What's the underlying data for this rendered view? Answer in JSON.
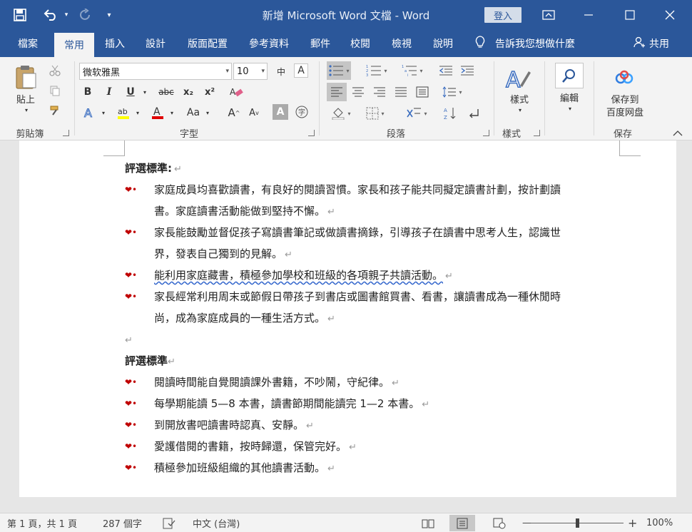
{
  "titlebar": {
    "title": "新增 Microsoft Word 文檔  -  Word",
    "login_label": "登入",
    "customize_label": "▾"
  },
  "tabs": [
    {
      "label": "檔案",
      "active": false
    },
    {
      "label": "常用",
      "active": true
    },
    {
      "label": "插入",
      "active": false
    },
    {
      "label": "設計",
      "active": false
    },
    {
      "label": "版面配置",
      "active": false
    },
    {
      "label": "參考資料",
      "active": false
    },
    {
      "label": "郵件",
      "active": false
    },
    {
      "label": "校閱",
      "active": false
    },
    {
      "label": "檢視",
      "active": false
    },
    {
      "label": "說明",
      "active": false
    }
  ],
  "tell_me": "告訴我您想做什麼",
  "share_label": "共用",
  "ribbon": {
    "clipboard": {
      "paste_label": "貼上",
      "group_label": "剪貼簿"
    },
    "font": {
      "font_name": "微软雅黑",
      "font_size": "10",
      "group_label": "字型",
      "bold": "B",
      "italic": "I",
      "underline": "U",
      "strike": "abc",
      "subscript": "x₂",
      "superscript": "x²",
      "case": "Aa",
      "grow": "A",
      "shrink": "A",
      "char_shade": "A",
      "phonetic": "中",
      "border_char": "A"
    },
    "paragraph": {
      "group_label": "段落"
    },
    "styles": {
      "label": "樣式",
      "group_label": "樣式"
    },
    "editing": {
      "label": "編輯"
    },
    "save": {
      "label_line1": "保存到",
      "label_line2": "百度网盘",
      "group_label": "保存"
    }
  },
  "document": {
    "section1": {
      "heading": "評選標準:",
      "items": [
        {
          "lines": [
            "家庭成員均喜歡讀書，有良好的閱讀習慣。家長和孩子能共同擬定讀書計劃，按計劃讀",
            "書。家庭讀書活動能做到堅持不懈。"
          ]
        },
        {
          "lines": [
            "家長能鼓勵並督促孩子寫讀書筆記或做讀書摘錄，引導孩子在讀書中思考人生，認識世",
            "界，發表自己獨到的見解。"
          ]
        },
        {
          "lines": [
            "能利用家庭藏書，積極參加學校和班級的各項親子共讀活動。"
          ]
        },
        {
          "lines": [
            "家長經常利用周末或節假日帶孩子到書店或圖書館買書、看書，讓讀書成為一種休閒時",
            "尚，成為家庭成員的一種生活方式。"
          ]
        }
      ]
    },
    "section2": {
      "heading": "評選標準",
      "items": [
        {
          "lines": [
            "閱讀時間能自覺閱讀課外書籍，不吵鬧，守紀律。"
          ]
        },
        {
          "lines": [
            "每學期能讀 5—8 本書，讀書節期間能讀完 1—2 本書。"
          ]
        },
        {
          "lines": [
            "到開放書吧讀書時認真、安靜。"
          ]
        },
        {
          "lines": [
            "愛護借閱的書籍，按時歸還，保管完好。"
          ]
        },
        {
          "lines": [
            "積極參加班級組織的其他讀書活動。"
          ]
        }
      ]
    },
    "para_mark": "↵",
    "bullet_glyph": "❤•"
  },
  "statusbar": {
    "page_info": "第 1 頁，共 1 頁",
    "word_count": "287 個字",
    "language": "中文 (台灣)",
    "zoom_minus": "—",
    "zoom_plus": "+",
    "zoom_level": "100%",
    "zoom_fraction": 0.5
  },
  "colors": {
    "brand": "#2b579a",
    "bullet": "#c00000"
  }
}
